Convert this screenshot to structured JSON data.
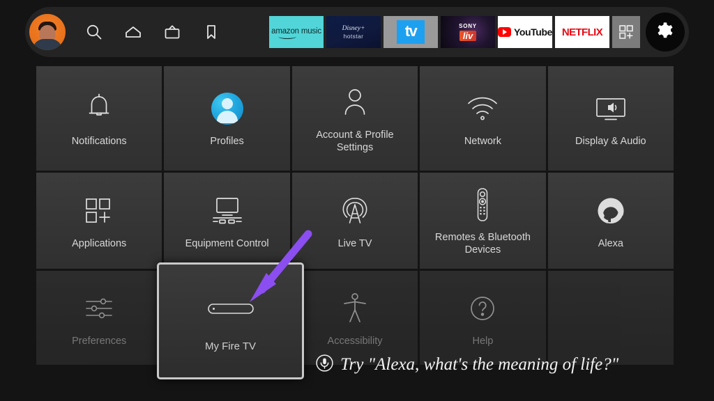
{
  "topbar": {
    "avatar": {
      "name": "profile-avatar",
      "alt": "User profile picture"
    },
    "nav_icons": [
      {
        "name": "search-icon",
        "label": "Search"
      },
      {
        "name": "home-icon",
        "label": "Home"
      },
      {
        "name": "live-tv-icon",
        "label": "Live"
      },
      {
        "name": "bookmark-icon",
        "label": "Watchlist"
      }
    ],
    "apps": [
      {
        "name": "amazon-music-app",
        "label": "amazon music",
        "brand_color": "#52d5d8"
      },
      {
        "name": "disney-hotstar-app",
        "label_top": "Disney+",
        "label_bottom": "hotstar",
        "brand_color": "#0d1b44"
      },
      {
        "name": "apple-tv-app",
        "label": "tv",
        "brand_color": "#1ea0f0"
      },
      {
        "name": "sony-liv-app",
        "label_top": "SONY",
        "label_bottom": "liv",
        "brand_color": "#201430"
      },
      {
        "name": "youtube-app",
        "label": "YouTube",
        "brand_color": "#ff0000"
      },
      {
        "name": "netflix-app",
        "label": "NETFLIX",
        "brand_color": "#e50914"
      }
    ],
    "apps_grid_button": {
      "name": "apps-grid-button",
      "label": "Apps"
    },
    "settings_button": {
      "name": "settings-gear-button",
      "label": "Settings",
      "selected": true
    }
  },
  "grid": {
    "rows": [
      [
        {
          "label": "Notifications",
          "icon": "bell-icon",
          "dimmed": false
        },
        {
          "label": "Profiles",
          "icon": "profiles-avatar-icon",
          "dimmed": false
        },
        {
          "label": "Account & Profile Settings",
          "icon": "person-icon",
          "dimmed": false
        },
        {
          "label": "Network",
          "icon": "wifi-icon",
          "dimmed": false
        },
        {
          "label": "Display & Audio",
          "icon": "display-audio-icon",
          "dimmed": false
        }
      ],
      [
        {
          "label": "Applications",
          "icon": "apps-grid-icon",
          "dimmed": false
        },
        {
          "label": "Equipment Control",
          "icon": "equipment-control-icon",
          "dimmed": false
        },
        {
          "label": "Live TV",
          "icon": "broadcast-tower-icon",
          "dimmed": false
        },
        {
          "label": "Remotes & Bluetooth Devices",
          "icon": "remote-control-icon",
          "dimmed": false
        },
        {
          "label": "Alexa",
          "icon": "alexa-ring-icon",
          "dimmed": false
        }
      ],
      [
        {
          "label": "Preferences",
          "icon": "sliders-icon",
          "dimmed": true
        },
        {
          "label": "",
          "icon": "",
          "dimmed": true
        },
        {
          "label": "Accessibility",
          "icon": "accessibility-icon",
          "dimmed": true
        },
        {
          "label": "Help",
          "icon": "question-circle-icon",
          "dimmed": true
        },
        {
          "label": "",
          "icon": "",
          "dimmed": true
        }
      ]
    ],
    "selected_tile": {
      "label": "My Fire TV",
      "icon": "fire-tv-stick-icon",
      "selected": true
    }
  },
  "alexa_hint": {
    "icon": "microphone-icon",
    "text": "Try \"Alexa, what's the meaning of life?\""
  },
  "annotation": {
    "arrow": {
      "name": "callout-arrow",
      "color": "#8b4ef0",
      "points_to": "My Fire TV"
    }
  }
}
